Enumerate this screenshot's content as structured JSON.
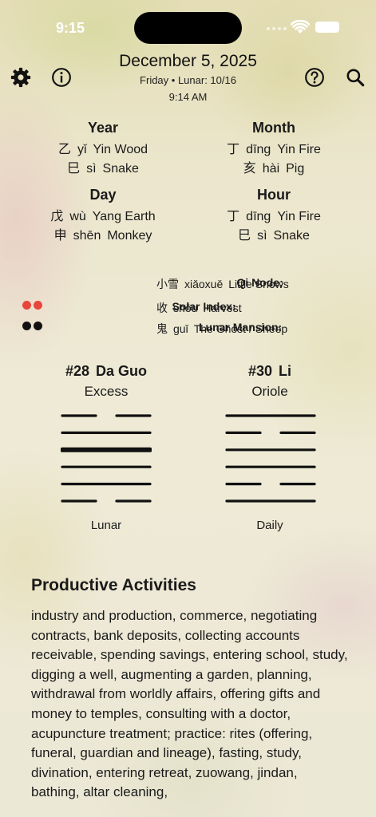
{
  "status": {
    "time": "9:15"
  },
  "header": {
    "date": "December 5, 2025",
    "subtitle": "Friday • Lunar: 10/16",
    "time": "9:14 AM"
  },
  "toolbar": {
    "icons": [
      "gear-icon",
      "info-icon",
      "help-icon",
      "search-icon"
    ]
  },
  "pillars": [
    {
      "heading": "Year",
      "stem": {
        "char": "乙",
        "pinyin": "yǐ",
        "meaning": "Yin Wood"
      },
      "branch": {
        "char": "巳",
        "pinyin": "sì",
        "meaning": "Snake"
      }
    },
    {
      "heading": "Month",
      "stem": {
        "char": "丁",
        "pinyin": "dīng",
        "meaning": "Yin Fire"
      },
      "branch": {
        "char": "亥",
        "pinyin": "hài",
        "meaning": "Pig"
      }
    },
    {
      "heading": "Day",
      "stem": {
        "char": "戊",
        "pinyin": "wù",
        "meaning": "Yang Earth"
      },
      "branch": {
        "char": "申",
        "pinyin": "shēn",
        "meaning": "Monkey"
      }
    },
    {
      "heading": "Hour",
      "stem": {
        "char": "丁",
        "pinyin": "dīng",
        "meaning": "Yin Fire"
      },
      "branch": {
        "char": "巳",
        "pinyin": "sì",
        "meaning": "Snake"
      }
    }
  ],
  "info": [
    {
      "label": "Qi Node:",
      "char": "小雪",
      "pinyin": "xiǎoxuě",
      "meaning": "Little Snows"
    },
    {
      "label": "Solar Index:",
      "char": "收",
      "pinyin": "shōu",
      "meaning": "Harvest",
      "dot_color": "#e8453c"
    },
    {
      "label": "Lunar Mansion:",
      "char": "鬼",
      "pinyin": "guǐ",
      "meaning": "The Ghost / Sheep",
      "dot_color": "#111111"
    }
  ],
  "hexagrams": [
    {
      "number": "#28",
      "name": "Da Guo",
      "meaning": "Excess",
      "caption": "Lunar",
      "lines_top_to_bottom": [
        "broken",
        "solid",
        "solid",
        "solid",
        "solid",
        "broken"
      ],
      "emphasized_line_index": 2
    },
    {
      "number": "#30",
      "name": "Li",
      "meaning": "Oriole",
      "caption": "Daily",
      "lines_top_to_bottom": [
        "solid",
        "broken",
        "solid",
        "solid",
        "broken",
        "solid"
      ],
      "emphasized_line_index": -1
    }
  ],
  "activities": {
    "title": "Productive Activities",
    "text": "industry and production, commerce, negotiating contracts, bank deposits, collecting accounts receivable, spending savings, entering school, study, digging a well, augmenting a garden, planning, withdrawal from worldly affairs, offering gifts and money to temples, consulting with a doctor, acupuncture treatment; practice: rites (offering, funeral, guardian and lineage), fasting, study, divination, entering retreat, zuowang, jindan, bathing, altar cleaning,"
  }
}
